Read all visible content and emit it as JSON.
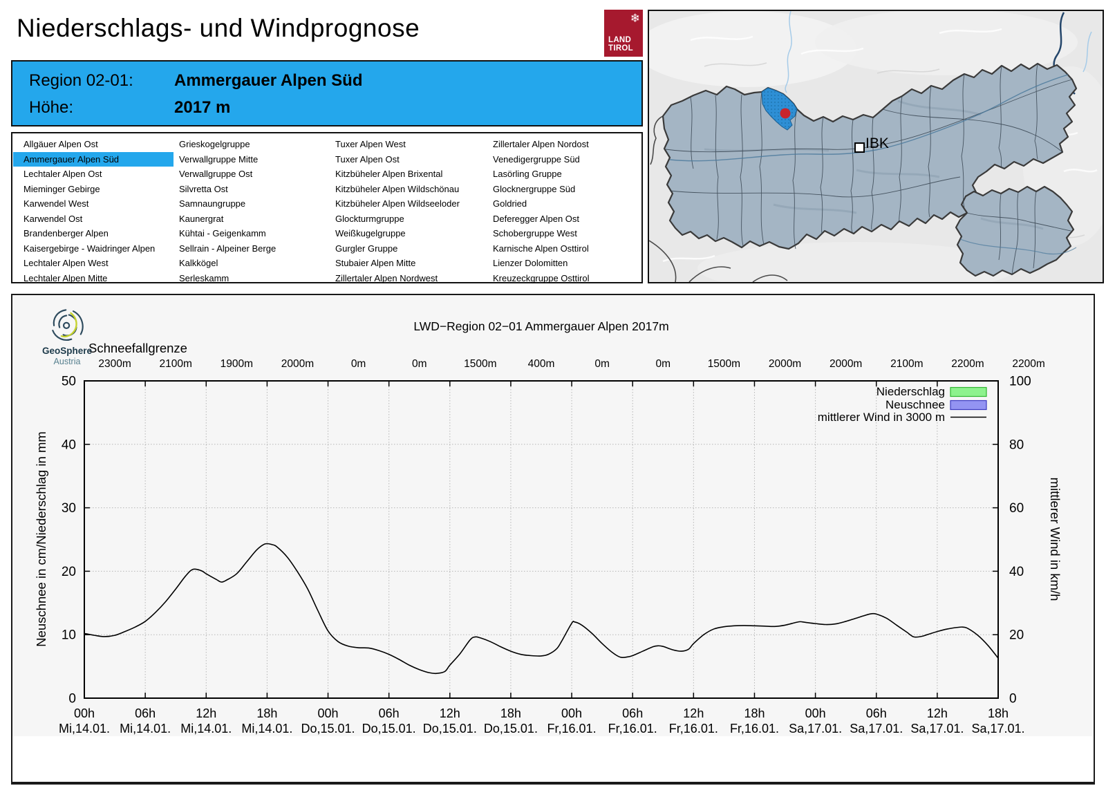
{
  "header": {
    "title": "Niederschlags- und Windprognose",
    "logo_line1": "LAND",
    "logo_line2": "TIROL",
    "snowflake": "❄"
  },
  "region_header": {
    "region_label": "Region 02-01:",
    "region_name": "Ammergauer Alpen Süd",
    "altitude_label": "Höhe:",
    "altitude_value": "2017 m"
  },
  "region_list": {
    "selected": "Ammergauer Alpen Süd",
    "columns": [
      [
        "Allgäuer Alpen Ost",
        "Ammergauer Alpen Süd",
        "Lechtaler Alpen Ost",
        "Mieminger Gebirge",
        "Karwendel West",
        "Karwendel Ost",
        "Brandenberger Alpen",
        "Kaisergebirge - Waidringer Alpen",
        "Lechtaler Alpen West",
        "Lechtaler Alpen Mitte"
      ],
      [
        "Grieskogelgruppe",
        "Verwallgruppe Mitte",
        "Verwallgruppe Ost",
        "Silvretta Ost",
        "Samnaungruppe",
        "Kaunergrat",
        "Kühtai - Geigenkamm",
        "Sellrain - Alpeiner Berge",
        "Kalkkögel",
        "Serleskamm"
      ],
      [
        "Tuxer Alpen West",
        "Tuxer Alpen Ost",
        "Kitzbüheler Alpen Brixental",
        "Kitzbüheler Alpen Wildschönau",
        "Kitzbüheler Alpen Wildseeloder",
        "Glockturmgruppe",
        "Weißkugelgruppe",
        "Gurgler Gruppe",
        "Stubaier Alpen Mitte",
        "Zillertaler Alpen Nordwest"
      ],
      [
        "Zillertaler Alpen Nordost",
        "Venedigergruppe Süd",
        "Lasörling Gruppe",
        "Glocknergruppe Süd",
        "Goldried",
        "Deferegger Alpen Ost",
        "Schobergruppe West",
        "Karnische Alpen Osttirol",
        "Lienzer Dolomitten",
        "Kreuzeckgruppe Osttirol"
      ]
    ]
  },
  "map": {
    "city_label": "IBK",
    "colors": {
      "background": "#e8e8e8",
      "region_fill": "#a4b5c4",
      "highlight_fill": "#2E8FD5",
      "marker_dot": "#C8252C",
      "border": "#3a3a3a"
    }
  },
  "geosphere": {
    "name": "GeoSphere",
    "country": "Austria"
  },
  "chart_data": {
    "type": "line",
    "title": "LWD−Region 02−01 Ammergauer Alpen 2017m",
    "background": "#f6f6f6",
    "snowline": {
      "label": "Schneefallgrenze",
      "values": [
        "2300m",
        "2100m",
        "1900m",
        "2000m",
        "0m",
        "0m",
        "1500m",
        "400m",
        "0m",
        "0m",
        "1500m",
        "2000m",
        "2000m",
        "2100m",
        "2200m",
        "2200m"
      ]
    },
    "x_ticks": {
      "hours_between_ticks": 6,
      "times": [
        "00h",
        "06h",
        "12h",
        "18h",
        "00h",
        "06h",
        "12h",
        "18h",
        "00h",
        "06h",
        "12h",
        "18h",
        "00h",
        "06h",
        "12h",
        "18h"
      ],
      "dates": [
        "Mi,14.01.",
        "Mi,14.01.",
        "Mi,14.01.",
        "Mi,14.01.",
        "Do,15.01.",
        "Do,15.01.",
        "Do,15.01.",
        "Do,15.01.",
        "Fr,16.01.",
        "Fr,16.01.",
        "Fr,16.01.",
        "Fr,16.01.",
        "Sa,17.01.",
        "Sa,17.01.",
        "Sa,17.01.",
        "Sa,17.01."
      ]
    },
    "axes": {
      "left": {
        "label": "Neuschnee in cm/Niederschlag in mm",
        "ticks": [
          0,
          10,
          20,
          30,
          40,
          50
        ],
        "range": [
          0,
          50
        ]
      },
      "right": {
        "label": "mittlerer Wind in km/h",
        "ticks": [
          0,
          20,
          40,
          60,
          80,
          100
        ],
        "range": [
          0,
          100
        ]
      }
    },
    "legend": [
      {
        "label": "Niederschlag",
        "swatch": "box",
        "fill": "#8DF28D",
        "border": "#2FB52F"
      },
      {
        "label": "Neuschnee",
        "swatch": "box",
        "fill": "#9394F2",
        "border": "#3B3BC0"
      },
      {
        "label": "mittlerer Wind in 3000 m",
        "swatch": "line",
        "color": "#000000"
      }
    ],
    "series": [
      {
        "name": "Niederschlag",
        "unit": "mm",
        "axis": "left",
        "type": "bar",
        "values_per_6h": [
          0,
          0,
          0,
          0,
          0,
          0,
          0,
          0,
          0,
          0,
          0,
          0,
          0,
          0,
          0
        ]
      },
      {
        "name": "Neuschnee",
        "unit": "cm",
        "axis": "left",
        "type": "bar",
        "values_per_6h": [
          0,
          0,
          0,
          0,
          0,
          0,
          0,
          0,
          0,
          0,
          0,
          0,
          0,
          0,
          0
        ]
      },
      {
        "name": "mittlerer Wind in 3000 m",
        "unit": "km/h",
        "axis": "right",
        "type": "line",
        "points": [
          [
            0,
            20.4
          ],
          [
            1,
            19.8
          ],
          [
            2,
            19.4
          ],
          [
            3,
            19.8
          ],
          [
            4,
            21.0
          ],
          [
            5,
            22.4
          ],
          [
            6,
            24.2
          ],
          [
            7,
            27.0
          ],
          [
            8,
            30.4
          ],
          [
            9,
            34.4
          ],
          [
            10,
            38.6
          ],
          [
            10.7,
            40.6
          ],
          [
            11.5,
            40.2
          ],
          [
            12,
            39.2
          ],
          [
            13,
            37.4
          ],
          [
            13.5,
            36.6
          ],
          [
            14,
            37.2
          ],
          [
            15,
            39.2
          ],
          [
            16,
            43.0
          ],
          [
            17,
            46.8
          ],
          [
            17.8,
            48.6
          ],
          [
            18.5,
            48.4
          ],
          [
            19,
            47.6
          ],
          [
            20,
            44.4
          ],
          [
            21,
            39.8
          ],
          [
            22,
            34.4
          ],
          [
            23,
            27.6
          ],
          [
            24,
            21.2
          ],
          [
            25,
            17.8
          ],
          [
            26,
            16.4
          ],
          [
            27,
            15.9
          ],
          [
            28,
            15.8
          ],
          [
            29,
            15.0
          ],
          [
            30,
            13.8
          ],
          [
            31,
            12.2
          ],
          [
            32,
            10.4
          ],
          [
            33,
            9.0
          ],
          [
            34,
            8.0
          ],
          [
            34.7,
            7.8
          ],
          [
            35.5,
            8.4
          ],
          [
            36,
            10.4
          ],
          [
            37,
            14.0
          ],
          [
            38,
            18.4
          ],
          [
            38.5,
            19.3
          ],
          [
            39,
            19.0
          ],
          [
            40,
            17.8
          ],
          [
            41,
            16.2
          ],
          [
            42,
            14.8
          ],
          [
            43,
            13.8
          ],
          [
            44,
            13.4
          ],
          [
            45,
            13.3
          ],
          [
            45.7,
            13.8
          ],
          [
            46.5,
            15.5
          ],
          [
            47,
            17.9
          ],
          [
            48,
            23.6
          ],
          [
            48.3,
            24.0
          ],
          [
            49,
            23.0
          ],
          [
            50,
            20.4
          ],
          [
            51,
            17.2
          ],
          [
            52,
            14.4
          ],
          [
            52.8,
            12.9
          ],
          [
            53.5,
            13.0
          ],
          [
            54,
            13.4
          ],
          [
            55,
            14.8
          ],
          [
            56,
            16.2
          ],
          [
            56.5,
            16.5
          ],
          [
            57,
            16.3
          ],
          [
            58,
            15.2
          ],
          [
            58.8,
            14.8
          ],
          [
            59.5,
            15.4
          ],
          [
            60,
            17.2
          ],
          [
            61,
            20.0
          ],
          [
            62,
            21.8
          ],
          [
            63,
            22.5
          ],
          [
            64,
            22.8
          ],
          [
            65,
            22.9
          ],
          [
            66,
            22.8
          ],
          [
            67,
            22.7
          ],
          [
            68,
            22.6
          ],
          [
            69,
            23.0
          ],
          [
            70,
            23.8
          ],
          [
            70.5,
            24.1
          ],
          [
            71,
            23.9
          ],
          [
            72,
            23.5
          ],
          [
            73,
            23.2
          ],
          [
            74,
            23.4
          ],
          [
            75,
            24.2
          ],
          [
            76,
            25.2
          ],
          [
            77,
            26.2
          ],
          [
            77.5,
            26.6
          ],
          [
            78,
            26.5
          ],
          [
            79,
            25.2
          ],
          [
            80,
            23.0
          ],
          [
            81,
            20.8
          ],
          [
            81.7,
            19.3
          ],
          [
            82.5,
            19.5
          ],
          [
            83,
            20.0
          ],
          [
            84,
            21.0
          ],
          [
            85,
            21.8
          ],
          [
            86,
            22.3
          ],
          [
            86.5,
            22.4
          ],
          [
            87,
            22.0
          ],
          [
            88,
            19.8
          ],
          [
            89,
            16.6
          ],
          [
            90,
            12.6
          ]
        ]
      }
    ]
  }
}
